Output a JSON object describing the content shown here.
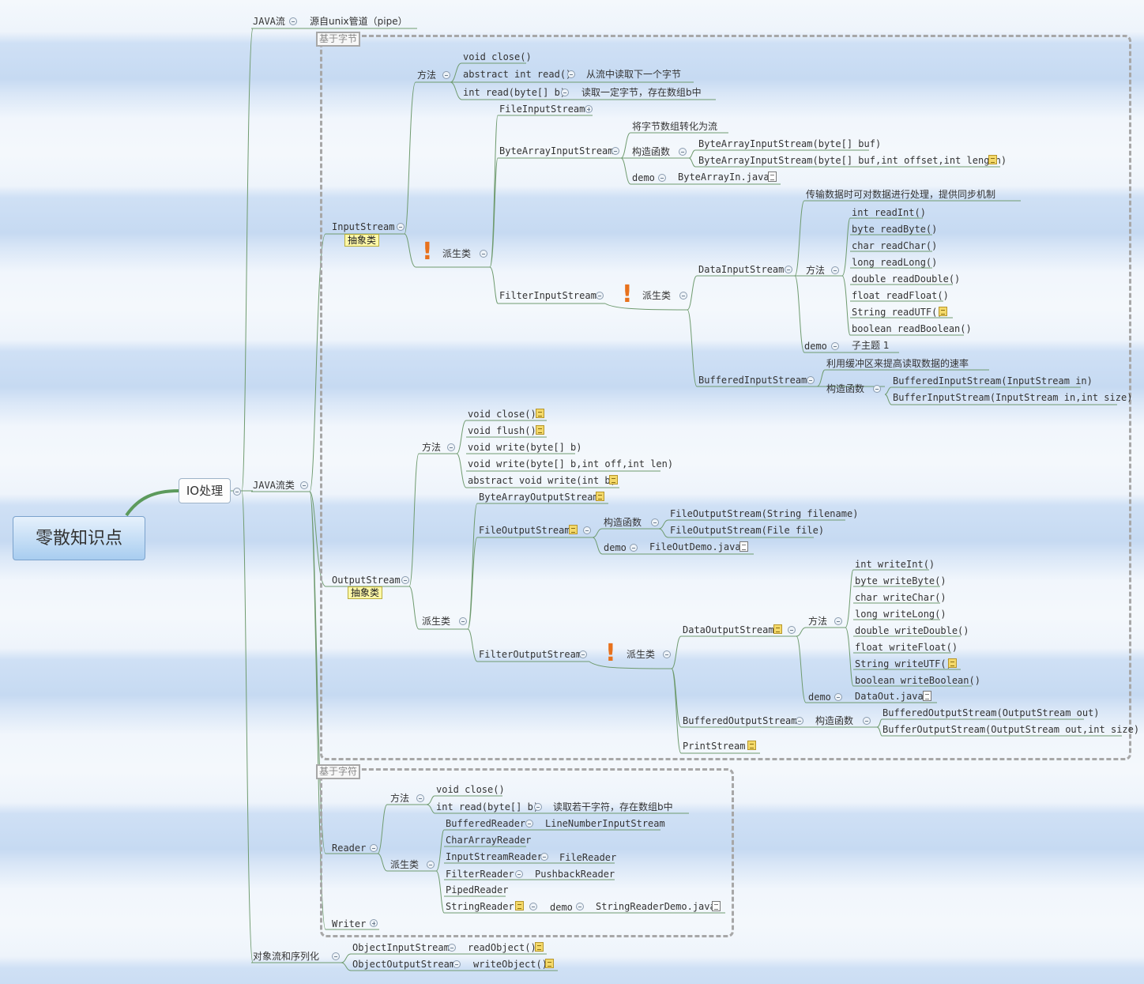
{
  "root": {
    "label": "零散知识点"
  },
  "io": {
    "label": "IO处理"
  },
  "javastream": {
    "label": "JAVA流",
    "child": "源自unix管道（pipe）"
  },
  "javaclass": {
    "label": "JAVA流类"
  },
  "groups": {
    "byte": "基于字节",
    "char": "基于字符"
  },
  "tags": {
    "abstract": "抽象类"
  },
  "input": {
    "label": "InputStream",
    "methods_label": "方法",
    "methods": [
      "void close()",
      "abstract int read()",
      "int read(byte[] b)"
    ],
    "method_notes": [
      "从流中读取下一个字节",
      "读取一定字节，存在数组b中"
    ],
    "derived_label": "派生类",
    "file": "FileInputStream",
    "bytearray": {
      "label": "ByteArrayInputStream",
      "desc": "将字节数组转化为流",
      "ctor_label": "构造函数",
      "ctors": [
        "ByteArrayInputStream(byte[] buf)",
        "ByteArrayInputStream(byte[] buf,int offset,int length)"
      ],
      "demo_label": "demo",
      "demo": "ByteArrayIn.java"
    },
    "filter": {
      "label": "FilterInputStream",
      "derived_label": "派生类",
      "data": {
        "label": "DataInputStream",
        "desc": "传输数据时可对数据进行处理，提供同步机制",
        "methods_label": "方法",
        "methods": [
          "int readInt()",
          "byte readByte()",
          "char readChar()",
          "long readLong()",
          "double readDouble()",
          "float readFloat()",
          "String readUTF()",
          "boolean readBoolean()"
        ],
        "demo_label": "demo",
        "demo": "子主题 1"
      },
      "buffered": {
        "label": "BufferedInputStream",
        "desc": "利用缓冲区来提高读取数据的速率",
        "ctor_label": "构造函数",
        "ctors": [
          "BufferedInputStream(InputStream in)",
          "BufferInputStream(InputStream in,int size)"
        ]
      }
    }
  },
  "output": {
    "label": "OutputStream",
    "methods_label": "方法",
    "methods": [
      "void close()",
      "void flush()",
      "void write(byte[] b)",
      "void write(byte[] b,int off,int len)",
      "abstract void write(int b)"
    ],
    "derived_label": "派生类",
    "bytearray": "ByteArrayOutputStream",
    "file": {
      "label": "FileOutputStream",
      "ctor_label": "构造函数",
      "ctors": [
        "FileOutputStream(String filename)",
        "FileOutputStream(File file)"
      ],
      "demo_label": "demo",
      "demo": "FileOutDemo.java"
    },
    "filter": {
      "label": "FilterOutputStream",
      "derived_label": "派生类",
      "data": {
        "label": "DataOutputStream",
        "methods_label": "方法",
        "methods": [
          "int writeInt()",
          "byte writeByte()",
          "char writeChar()",
          "long writeLong()",
          "double writeDouble()",
          "float writeFloat()",
          "String writeUTF()",
          "boolean writeBoolean()"
        ],
        "demo_label": "demo",
        "demo": "DataOut.java"
      },
      "buffered": {
        "label": "BufferedOutputStream",
        "ctor_label": "构造函数",
        "ctors": [
          "BufferedOutputStream(OutputStream out)",
          "BufferOutputStream(OutputStream out,int size)"
        ]
      },
      "print": "PrintStream"
    }
  },
  "reader": {
    "label": "Reader",
    "methods_label": "方法",
    "methods": [
      "void close()",
      "int read(byte[] b)"
    ],
    "method_note": "读取若干字符，存在数组b中",
    "derived_label": "派生类",
    "derived": [
      "BufferedReader",
      "CharArrayReader",
      "InputStreamReader",
      "FilterReader",
      "PipedReader",
      "StringReader"
    ],
    "derived_children": [
      "LineNumberInputStream",
      "FileReader",
      "PushbackReader"
    ],
    "demo_label": "demo",
    "demo": "StringReaderDemo.java"
  },
  "writer": {
    "label": "Writer"
  },
  "objstream": {
    "label": "对象流和序列化",
    "items": [
      "ObjectInputStream",
      "ObjectOutputStream"
    ],
    "methods": [
      "readObject()",
      "writeObject()"
    ]
  }
}
